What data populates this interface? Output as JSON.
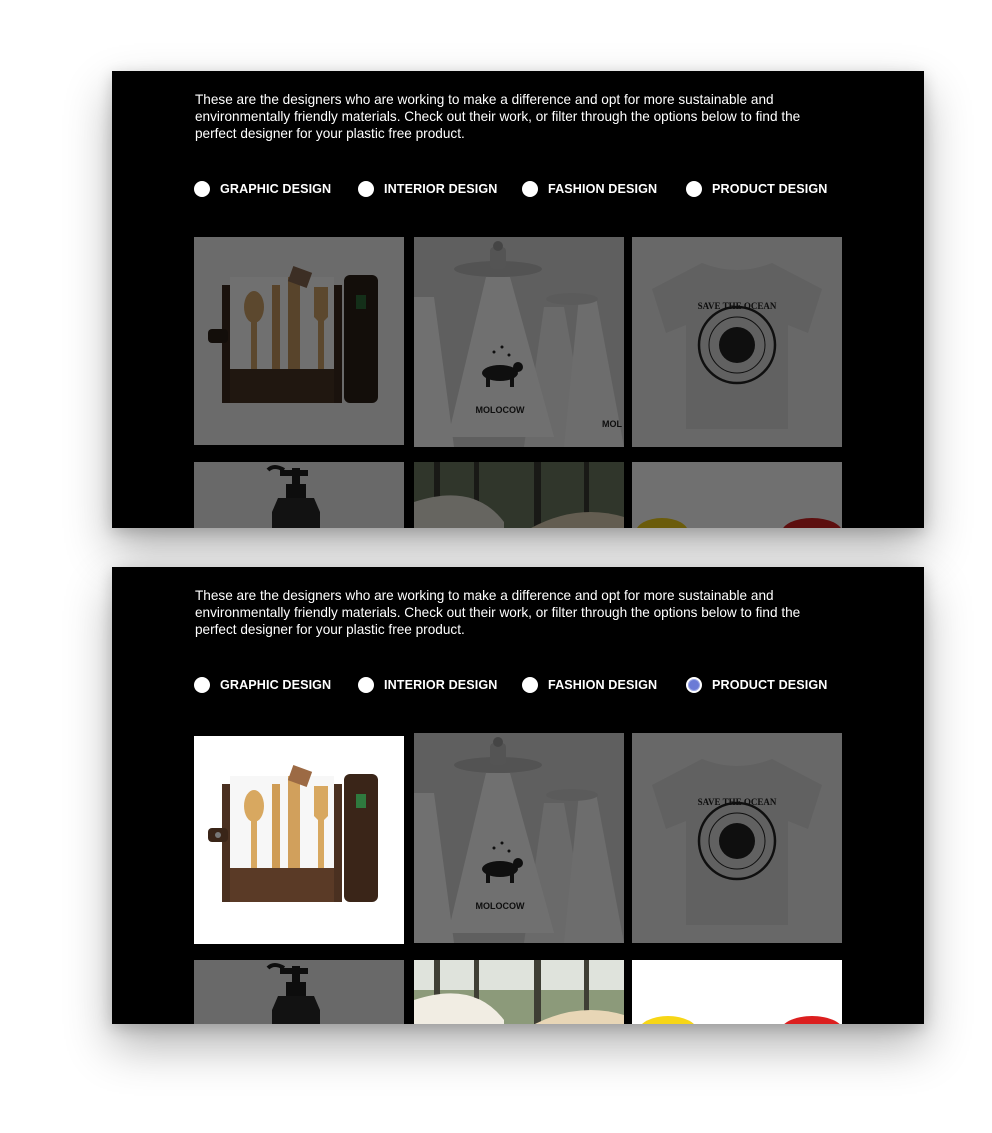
{
  "panels": [
    {
      "intro": "These are the designers who are working to make a difference and opt for more sustainable and environmentally friendly materials. Check out their work, or filter through the options below to find the perfect designer for your plastic free product.",
      "filters": [
        {
          "label": "GRAPHIC DESIGN",
          "selected": false
        },
        {
          "label": "INTERIOR DESIGN",
          "selected": false
        },
        {
          "label": "FASHION DESIGN",
          "selected": false
        },
        {
          "label": "PRODUCT DESIGN",
          "selected": false
        }
      ]
    },
    {
      "intro": "These are the designers who are working to make a difference and opt for more sustainable and environmentally friendly materials. Check out their work, or filter through the options below to find the perfect designer for your plastic free product.",
      "filters": [
        {
          "label": "GRAPHIC DESIGN",
          "selected": false
        },
        {
          "label": "INTERIOR DESIGN",
          "selected": false
        },
        {
          "label": "FASHION DESIGN",
          "selected": false
        },
        {
          "label": "PRODUCT DESIGN",
          "selected": true
        }
      ]
    }
  ],
  "artwork": {
    "bottle_brand": "MOLOCOW",
    "bottle_brand_partial": "MOL",
    "tshirt_text": "SAVE THE OCEAN"
  },
  "colors": {
    "panel_background": "#000000",
    "radio_selected": "#6b7bd6",
    "radio_unselected": "#ffffff"
  }
}
